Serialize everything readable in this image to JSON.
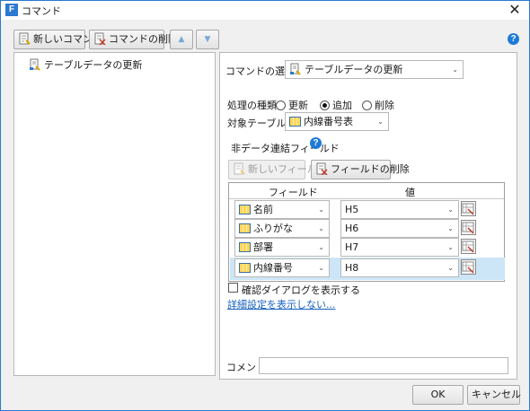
{
  "window": {
    "title": "コマンド",
    "app_icon_letter": "F",
    "close_glyph": "✕"
  },
  "toolbar": {
    "new_command": "新しいコマンド",
    "delete_command": "コマンドの削除",
    "up_glyph": "▲",
    "down_glyph": "▼",
    "help_glyph": "?"
  },
  "tree": {
    "items": [
      {
        "label": "テーブルデータの更新",
        "icon": "table-update-icon"
      }
    ]
  },
  "panel": {
    "command_select_label": "コマンドの選択：",
    "command_select_value": "テーブルデータの更新",
    "process_type_label": "処理の種類",
    "process_options": [
      {
        "label": "更新",
        "selected": false
      },
      {
        "label": "追加",
        "selected": true
      },
      {
        "label": "削除",
        "selected": false
      }
    ],
    "target_table_label": "対象テーブル：",
    "target_table_value": "内線番号表",
    "non_data_fields_label": "非データ連結フィールド",
    "help_glyph": "?",
    "new_field_button": "新しいフィールド",
    "delete_field_button": "フィールドの削除",
    "grid": {
      "headers": {
        "field": "フィールド",
        "value": "値"
      },
      "rows": [
        {
          "field": "名前",
          "value": "H5",
          "selected": false
        },
        {
          "field": "ふりがな",
          "value": "H6",
          "selected": false
        },
        {
          "field": "部署",
          "value": "H7",
          "selected": false
        },
        {
          "field": "内線番号",
          "value": "H8",
          "selected": true
        }
      ]
    },
    "confirm_dialog_label": "確認ダイアログを表示する",
    "confirm_dialog_checked": false,
    "advanced_link": "詳細設定を表示しない...",
    "comment_label": "コメント",
    "comment_value": ""
  },
  "footer": {
    "ok": "OK",
    "cancel": "キャンセル"
  },
  "colors": {
    "accent": "#2b79d0",
    "help": "#1e7ad8",
    "selection": "#cde6f7",
    "link": "#1560bd"
  }
}
